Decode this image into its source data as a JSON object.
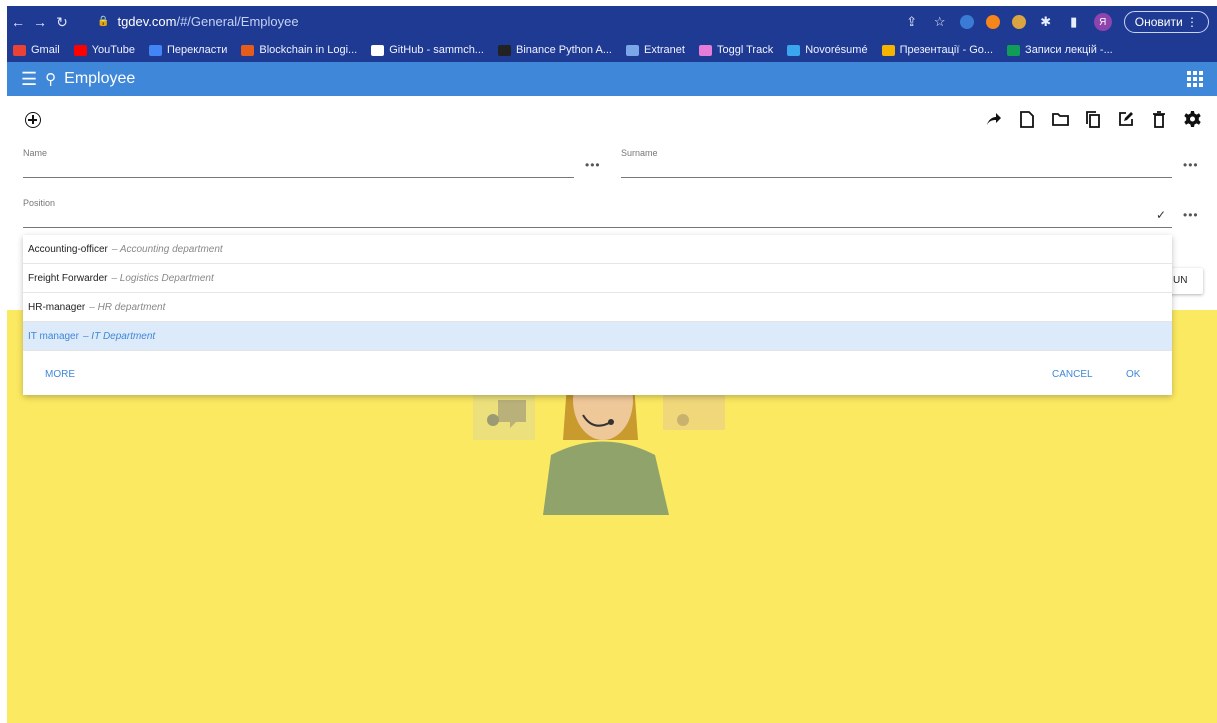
{
  "browser": {
    "url_host": "tgdev.com",
    "url_path": "/#/General/Employee",
    "update_button": "Оновити",
    "profile_letter": "Я"
  },
  "bookmarks": [
    {
      "label": "Gmail",
      "color": "#ea4335"
    },
    {
      "label": "YouTube",
      "color": "#ff0000"
    },
    {
      "label": "Перекласти",
      "color": "#4285f4"
    },
    {
      "label": "Blockchain in Logi...",
      "color": "#e65c1a"
    },
    {
      "label": "GitHub - sammch...",
      "color": "#ffffff"
    },
    {
      "label": "Binance Python A...",
      "color": "#222222"
    },
    {
      "label": "Extranet",
      "color": "#7aa7e8"
    },
    {
      "label": "Toggl Track",
      "color": "#e57cd8"
    },
    {
      "label": "Novorésumé",
      "color": "#3aa6f0"
    },
    {
      "label": "Презентації - Go...",
      "color": "#f4b400"
    },
    {
      "label": "Записи лекцій -...",
      "color": "#0f9d58"
    }
  ],
  "appbar": {
    "title": "Employee"
  },
  "form": {
    "name_label": "Name",
    "surname_label": "Surname",
    "position_label": "Position",
    "more_dots": "•••"
  },
  "dropdown": {
    "options": [
      {
        "name": "Accounting-officer",
        "dept": "– Accounting department",
        "selected": false
      },
      {
        "name": "Freight Forwarder",
        "dept": "– Logistics Department",
        "selected": false
      },
      {
        "name": "HR-manager",
        "dept": "– HR department",
        "selected": false
      },
      {
        "name": "IT manager",
        "dept": "– IT Department",
        "selected": true
      }
    ],
    "more_label": "MORE",
    "cancel_label": "CANCEL",
    "ok_label": "OK"
  },
  "hidden_button_text": "UN",
  "colors": {
    "chrome": "#1f3a93",
    "appbar": "#3f87d9",
    "accent": "#3f87d9",
    "yellow": "#fbe961"
  }
}
